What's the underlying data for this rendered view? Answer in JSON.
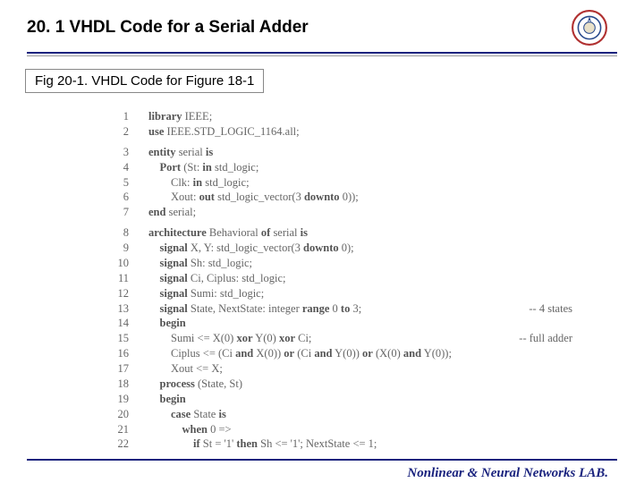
{
  "header": {
    "title": "20. 1 VHDL Code for a Serial Adder"
  },
  "subtitle": "Fig 20-1. VHDL Code for Figure 18-1",
  "code": {
    "lines": [
      {
        "n": "1",
        "indent": 0,
        "t": [
          {
            "k": true,
            "s": "library"
          },
          {
            "k": false,
            "s": " IEEE;"
          }
        ]
      },
      {
        "n": "2",
        "indent": 0,
        "t": [
          {
            "k": true,
            "s": "use"
          },
          {
            "k": false,
            "s": " IEEE.STD_LOGIC_1164.all;"
          }
        ]
      },
      {
        "n": "",
        "blank": true
      },
      {
        "n": "3",
        "indent": 0,
        "t": [
          {
            "k": true,
            "s": "entity"
          },
          {
            "k": false,
            "s": " serial "
          },
          {
            "k": true,
            "s": "is"
          }
        ]
      },
      {
        "n": "4",
        "indent": 1,
        "t": [
          {
            "k": true,
            "s": "Port"
          },
          {
            "k": false,
            "s": " (St: "
          },
          {
            "k": true,
            "s": "in"
          },
          {
            "k": false,
            "s": " std_logic;"
          }
        ]
      },
      {
        "n": "5",
        "indent": 2,
        "t": [
          {
            "k": false,
            "s": "Clk: "
          },
          {
            "k": true,
            "s": "in"
          },
          {
            "k": false,
            "s": " std_logic;"
          }
        ]
      },
      {
        "n": "6",
        "indent": 2,
        "t": [
          {
            "k": false,
            "s": "Xout: "
          },
          {
            "k": true,
            "s": "out"
          },
          {
            "k": false,
            "s": " std_logic_vector(3 "
          },
          {
            "k": true,
            "s": "downto"
          },
          {
            "k": false,
            "s": " 0));"
          }
        ]
      },
      {
        "n": "7",
        "indent": 0,
        "t": [
          {
            "k": true,
            "s": "end"
          },
          {
            "k": false,
            "s": " serial;"
          }
        ]
      },
      {
        "n": "",
        "blank": true
      },
      {
        "n": "8",
        "indent": 0,
        "t": [
          {
            "k": true,
            "s": "architecture"
          },
          {
            "k": false,
            "s": " Behavioral "
          },
          {
            "k": true,
            "s": "of"
          },
          {
            "k": false,
            "s": " serial "
          },
          {
            "k": true,
            "s": "is"
          }
        ]
      },
      {
        "n": "9",
        "indent": 1,
        "t": [
          {
            "k": true,
            "s": "signal"
          },
          {
            "k": false,
            "s": " X, Y: std_logic_vector(3 "
          },
          {
            "k": true,
            "s": "downto"
          },
          {
            "k": false,
            "s": " 0);"
          }
        ]
      },
      {
        "n": "10",
        "indent": 1,
        "t": [
          {
            "k": true,
            "s": "signal"
          },
          {
            "k": false,
            "s": " Sh: std_logic;"
          }
        ]
      },
      {
        "n": "11",
        "indent": 1,
        "t": [
          {
            "k": true,
            "s": "signal"
          },
          {
            "k": false,
            "s": " Ci, Ciplus: std_logic;"
          }
        ]
      },
      {
        "n": "12",
        "indent": 1,
        "t": [
          {
            "k": true,
            "s": "signal"
          },
          {
            "k": false,
            "s": " Sumi: std_logic;"
          }
        ]
      },
      {
        "n": "13",
        "indent": 1,
        "t": [
          {
            "k": true,
            "s": "signal"
          },
          {
            "k": false,
            "s": " State, NextState: integer "
          },
          {
            "k": true,
            "s": "range"
          },
          {
            "k": false,
            "s": " 0 "
          },
          {
            "k": true,
            "s": "to"
          },
          {
            "k": false,
            "s": " 3;"
          }
        ],
        "c": "-- 4 states"
      },
      {
        "n": "14",
        "indent": 1,
        "t": [
          {
            "k": true,
            "s": "begin"
          }
        ]
      },
      {
        "n": "15",
        "indent": 2,
        "t": [
          {
            "k": false,
            "s": "Sumi <= X(0) "
          },
          {
            "k": true,
            "s": "xor"
          },
          {
            "k": false,
            "s": " Y(0) "
          },
          {
            "k": true,
            "s": "xor"
          },
          {
            "k": false,
            "s": " Ci;"
          }
        ],
        "c": "-- full adder"
      },
      {
        "n": "16",
        "indent": 2,
        "t": [
          {
            "k": false,
            "s": "Ciplus <= (Ci "
          },
          {
            "k": true,
            "s": "and"
          },
          {
            "k": false,
            "s": " X(0)) "
          },
          {
            "k": true,
            "s": "or"
          },
          {
            "k": false,
            "s": " (Ci "
          },
          {
            "k": true,
            "s": "and"
          },
          {
            "k": false,
            "s": " Y(0)) "
          },
          {
            "k": true,
            "s": "or"
          },
          {
            "k": false,
            "s": " (X(0) "
          },
          {
            "k": true,
            "s": "and"
          },
          {
            "k": false,
            "s": " Y(0));"
          }
        ]
      },
      {
        "n": "17",
        "indent": 2,
        "t": [
          {
            "k": false,
            "s": "Xout <= X;"
          }
        ]
      },
      {
        "n": "18",
        "indent": 1,
        "t": [
          {
            "k": true,
            "s": "process"
          },
          {
            "k": false,
            "s": " (State, St)"
          }
        ]
      },
      {
        "n": "19",
        "indent": 1,
        "t": [
          {
            "k": true,
            "s": "begin"
          }
        ]
      },
      {
        "n": "20",
        "indent": 2,
        "t": [
          {
            "k": true,
            "s": "case"
          },
          {
            "k": false,
            "s": " State "
          },
          {
            "k": true,
            "s": "is"
          }
        ]
      },
      {
        "n": "21",
        "indent": 3,
        "t": [
          {
            "k": true,
            "s": "when"
          },
          {
            "k": false,
            "s": " 0 =>"
          }
        ]
      },
      {
        "n": "22",
        "indent": 4,
        "t": [
          {
            "k": true,
            "s": "if"
          },
          {
            "k": false,
            "s": " St = '1' "
          },
          {
            "k": true,
            "s": "then"
          },
          {
            "k": false,
            "s": " Sh <= '1'; NextState <= 1;"
          }
        ]
      }
    ]
  },
  "footer": "Nonlinear & Neural Networks LAB."
}
